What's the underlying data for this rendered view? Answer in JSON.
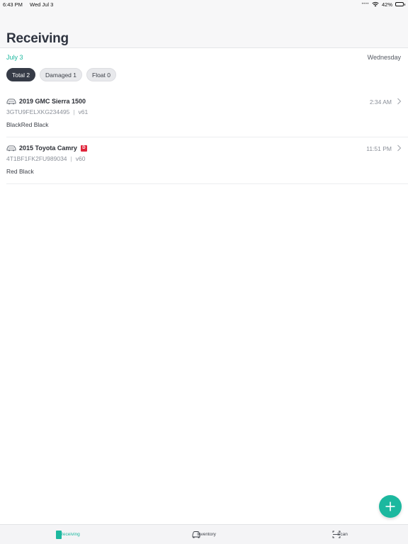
{
  "status_bar": {
    "time": "6:43 PM",
    "date": "Wed Jul 3",
    "battery": "42%",
    "battery_level": 0.42
  },
  "header": {
    "title": "Receiving"
  },
  "day": {
    "date": "July 3",
    "weekday": "Wednesday"
  },
  "filters": [
    {
      "label": "Total 2",
      "active": true
    },
    {
      "label": "Damaged 1",
      "active": false
    },
    {
      "label": "Float 0",
      "active": false
    }
  ],
  "vehicles": [
    {
      "title": "2019 GMC Sierra 1500",
      "vin": "3GTU9FELXKG234495",
      "separator": "|",
      "stock": "v61",
      "colors": "BlackRed Black",
      "time": "2:34 AM",
      "damaged": false
    },
    {
      "title": "2015 Toyota Camry",
      "damage_badge": "D",
      "vin": "4T1BF1FK2FU989034",
      "separator": "|",
      "stock": "v60",
      "colors": "Red Black",
      "time": "11:51 PM",
      "damaged": true
    }
  ],
  "tabs": [
    {
      "label": "Receiving",
      "icon": "receiving-icon",
      "active": true
    },
    {
      "label": "Inventory",
      "icon": "car-icon",
      "active": false
    },
    {
      "label": "Scan",
      "icon": "scan-icon",
      "active": false
    }
  ],
  "colors": {
    "accent": "#1cb89f",
    "damage": "#e0263c",
    "dark_pill": "#363b47"
  }
}
